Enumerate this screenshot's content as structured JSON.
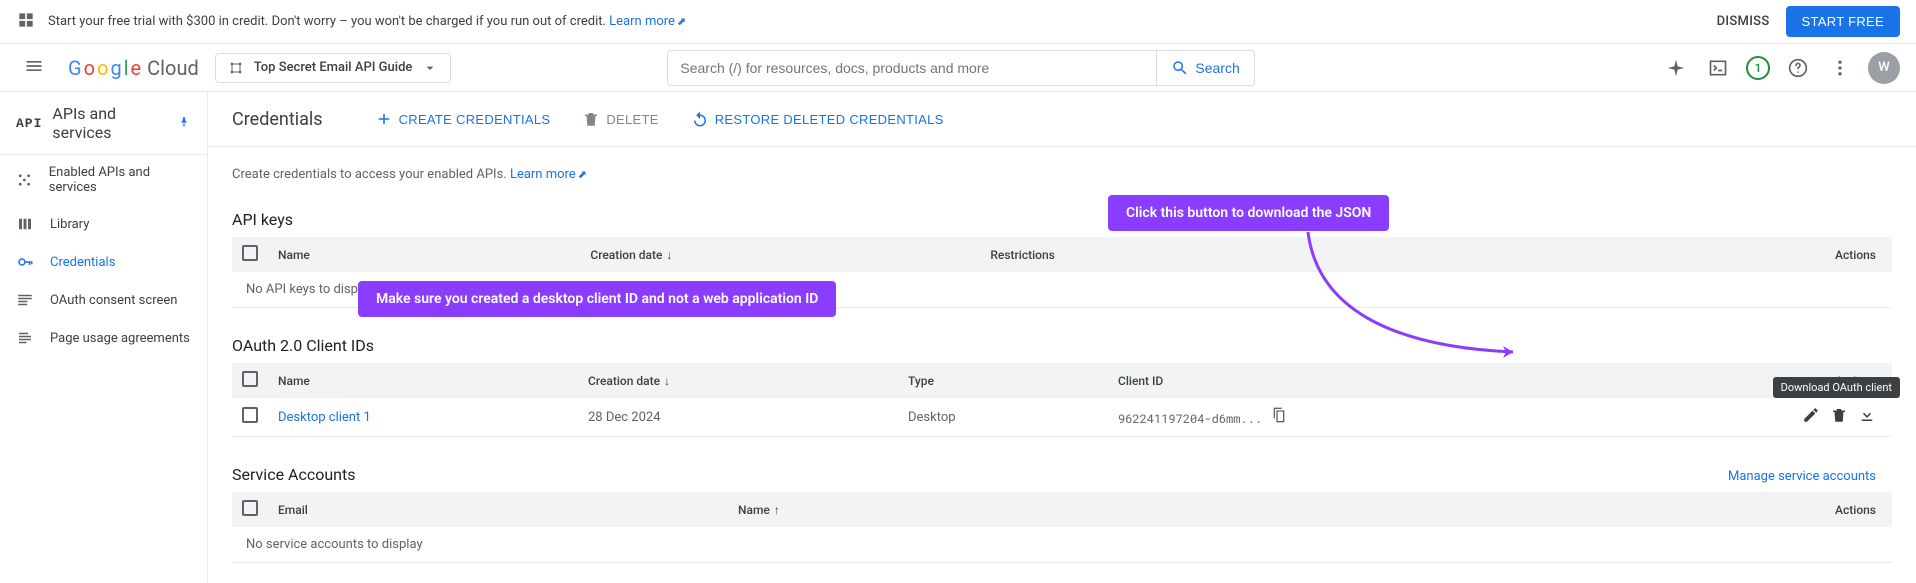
{
  "promo": {
    "text": "Start your free trial with $300 in credit. Don't worry – you won't be charged if you run out of credit. ",
    "learn_more": "Learn more",
    "dismiss": "DISMISS",
    "start_free": "START FREE"
  },
  "header": {
    "logo_cloud": "Cloud",
    "project_name": "Top Secret Email API Guide",
    "search_placeholder": "Search (/) for resources, docs, products and more",
    "search_label": "Search",
    "notification_count": "1",
    "avatar_letter": "W"
  },
  "sidebar": {
    "section_title": "APIs and services",
    "api_badge": "API",
    "items": [
      {
        "label": "Enabled APIs and services"
      },
      {
        "label": "Library"
      },
      {
        "label": "Credentials"
      },
      {
        "label": "OAuth consent screen"
      },
      {
        "label": "Page usage agreements"
      }
    ]
  },
  "page": {
    "title": "Credentials",
    "create": "CREATE CREDENTIALS",
    "delete": "DELETE",
    "restore": "RESTORE DELETED CREDENTIALS",
    "intro_text": "Create credentials to access your enabled APIs. ",
    "learn_more": "Learn more"
  },
  "api_keys": {
    "title": "API keys",
    "cols": {
      "name": "Name",
      "creation": "Creation date",
      "restrictions": "Restrictions",
      "actions": "Actions"
    },
    "empty": "No API keys to display"
  },
  "oauth": {
    "title": "OAuth 2.0 Client IDs",
    "cols": {
      "name": "Name",
      "creation": "Creation date",
      "type": "Type",
      "client_id": "Client ID",
      "actions": "Actions"
    },
    "row": {
      "name": "Desktop client 1",
      "creation": "28 Dec 2024",
      "type": "Desktop",
      "client_id": "962241197204-d6mm..."
    }
  },
  "service_accounts": {
    "title": "Service Accounts",
    "manage": "Manage service accounts",
    "cols": {
      "email": "Email",
      "name": "Name",
      "actions": "Actions"
    },
    "empty": "No service accounts to display"
  },
  "annotations": {
    "a1": "Click this button to download the JSON",
    "a2": "Make sure you created a desktop client ID and not a web application ID",
    "tooltip": "Download OAuth client"
  }
}
